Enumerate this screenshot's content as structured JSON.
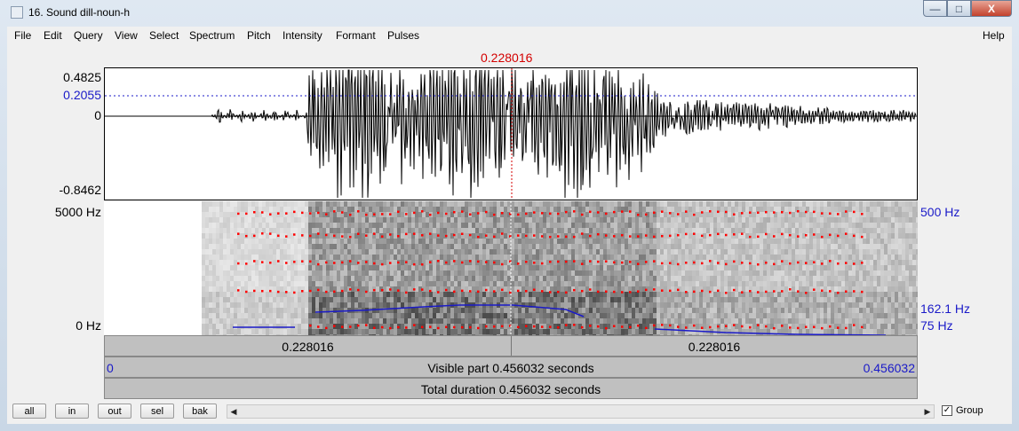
{
  "window": {
    "title": "16. Sound dill-noun-h",
    "controls": {
      "minimize": "—",
      "maximize": "□",
      "close": "X"
    }
  },
  "menu": {
    "items": [
      "File",
      "Edit",
      "Query",
      "View",
      "Select",
      "Spectrum",
      "Pitch",
      "Intensity",
      "Formant",
      "Pulses"
    ],
    "help": "Help"
  },
  "waveform": {
    "cursor_time": "0.228016",
    "y_max": "0.4825",
    "y_cursor": "0.2055",
    "y_zero": "0",
    "y_min": "-0.8462"
  },
  "spectrogram": {
    "freq_max": "5000 Hz",
    "freq_min": "0 Hz",
    "pitch_max": "500 Hz",
    "pitch_cursor": "162.1 Hz",
    "pitch_min": "75 Hz"
  },
  "timebars": {
    "left_segment": "0.228016",
    "right_segment": "0.228016",
    "visible_start": "0",
    "visible_label": "Visible part 0.456032 seconds",
    "visible_end": "0.456032",
    "total_label": "Total duration 0.456032 seconds"
  },
  "buttons": {
    "all": "all",
    "in": "in",
    "out": "out",
    "sel": "sel",
    "bak": "bak"
  },
  "scrollbar": {
    "left_arrow": "◀",
    "right_arrow": "▶"
  },
  "group": {
    "label": "Group",
    "checked": true,
    "check_mark": "✓"
  },
  "colors": {
    "cursor": "#d40000",
    "pitch": "#1a1ac8",
    "formant": "#ff0000"
  }
}
